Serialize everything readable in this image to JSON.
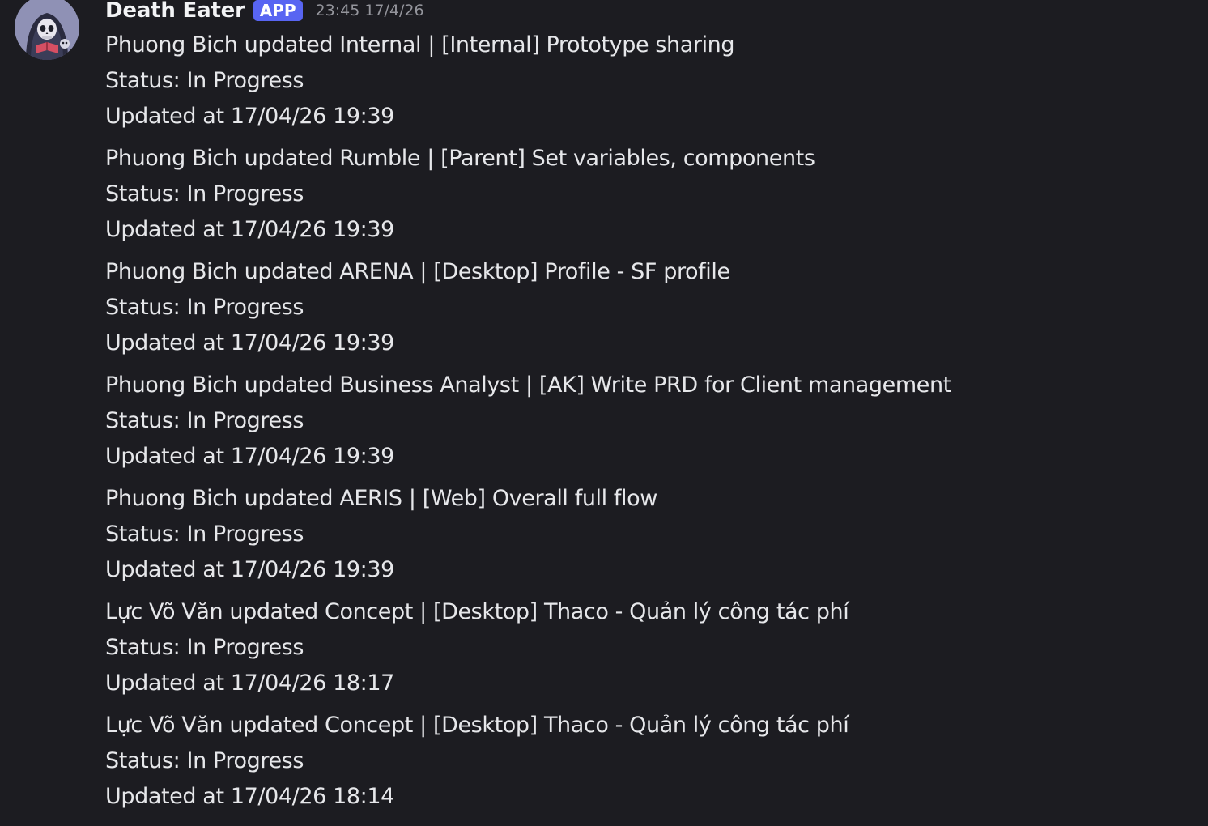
{
  "message": {
    "author": "Death Eater",
    "badge": "APP",
    "timestamp": "23:45 17/4/26",
    "entries": [
      {
        "title": "Phuong Bich updated Internal | [Internal] Prototype sharing",
        "status": "Status: In Progress",
        "updated": "Updated at 17/04/26 19:39"
      },
      {
        "title": "Phuong Bich updated Rumble | [Parent] Set variables, components",
        "status": "Status: In Progress",
        "updated": "Updated at 17/04/26 19:39"
      },
      {
        "title": "Phuong Bich updated ARENA | [Desktop] Profile - SF profile",
        "status": "Status: In Progress",
        "updated": "Updated at 17/04/26 19:39"
      },
      {
        "title": "Phuong Bich updated Business Analyst | [AK] Write PRD for Client management",
        "status": "Status: In Progress",
        "updated": "Updated at 17/04/26 19:39"
      },
      {
        "title": "Phuong Bich updated AERIS | [Web] Overall full flow",
        "status": "Status: In Progress",
        "updated": "Updated at 17/04/26 19:39"
      },
      {
        "title": "Lực Võ Văn updated Concept | [Desktop] Thaco - Quản lý công tác phí",
        "status": "Status: In Progress",
        "updated": "Updated at 17/04/26 18:17"
      },
      {
        "title": "Lực Võ Văn updated Concept | [Desktop] Thaco - Quản lý công tác phí",
        "status": "Status: In Progress",
        "updated": "Updated at 17/04/26 18:14"
      }
    ]
  },
  "colors": {
    "background": "#1c1c21",
    "text": "#e6e7ea",
    "username": "#f2f3f5",
    "badge": "#5865f2",
    "timestamp": "#94959c"
  },
  "icons": {
    "avatar": "reaper-skull-avatar-icon"
  }
}
